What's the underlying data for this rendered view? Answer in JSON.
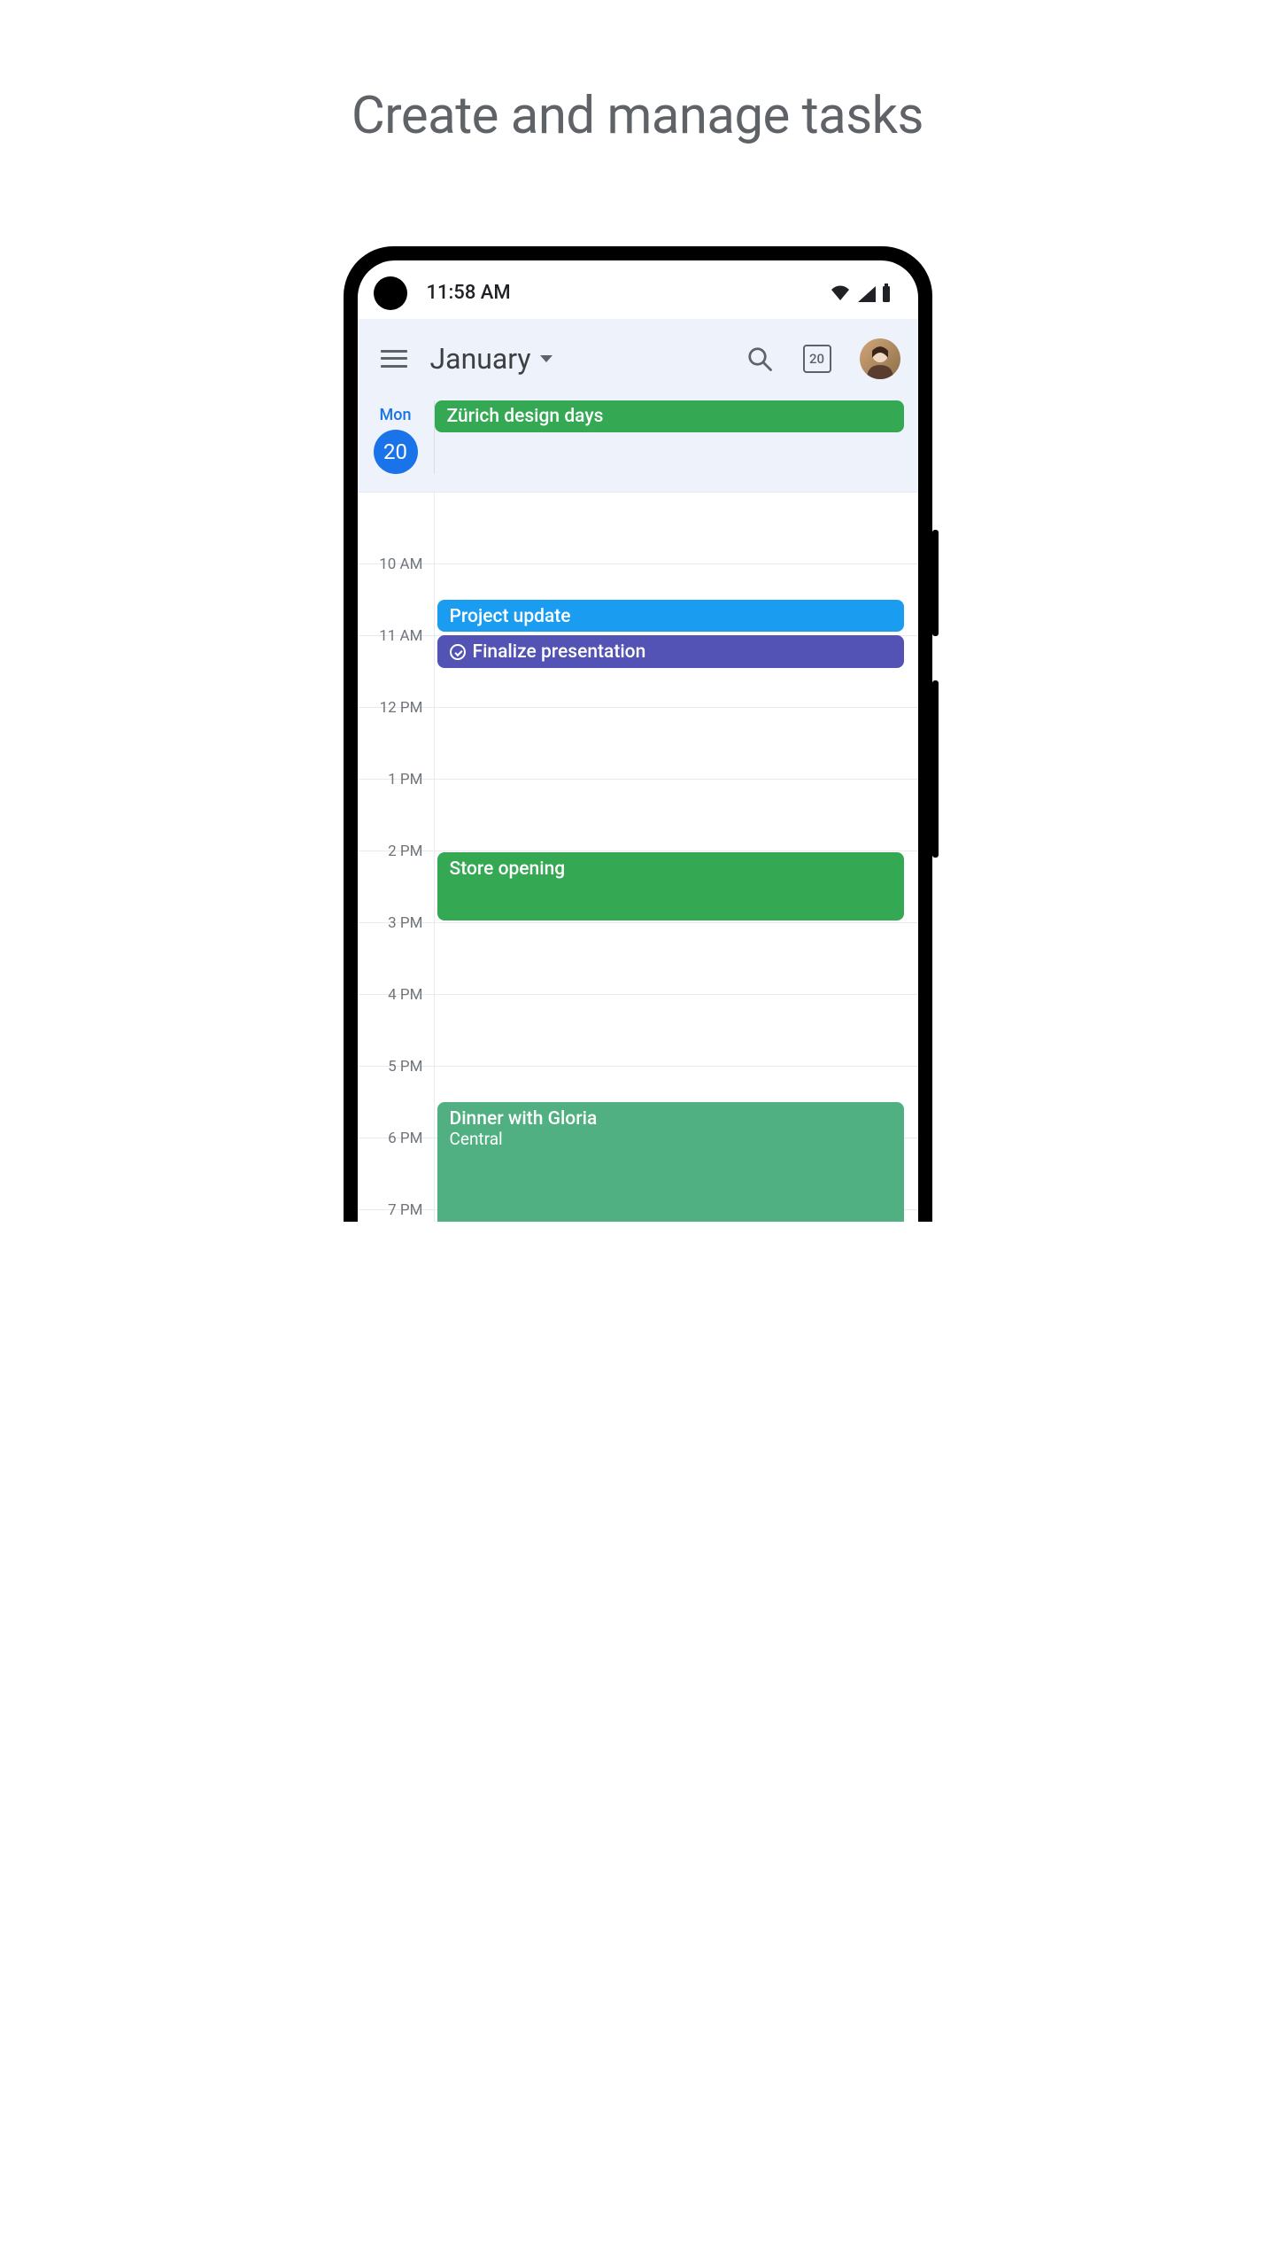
{
  "promo": {
    "title": "Create and manage tasks"
  },
  "status": {
    "time": "11:58 AM"
  },
  "header": {
    "month": "January",
    "today_day": "20"
  },
  "day": {
    "weekday": "Mon",
    "date": "20",
    "allday_event": "Zürich design days"
  },
  "hours": {
    "h10": "10 AM",
    "h11": "11 AM",
    "h12": "12 PM",
    "h13": "1 PM",
    "h14": "2 PM",
    "h15": "3 PM",
    "h16": "4 PM",
    "h17": "5 PM",
    "h18": "6 PM",
    "h19": "7 PM"
  },
  "events": {
    "project_update": "Project update",
    "finalize_presentation": "Finalize presentation",
    "store_opening": "Store opening",
    "dinner_title": "Dinner with Gloria",
    "dinner_location": "Central"
  }
}
